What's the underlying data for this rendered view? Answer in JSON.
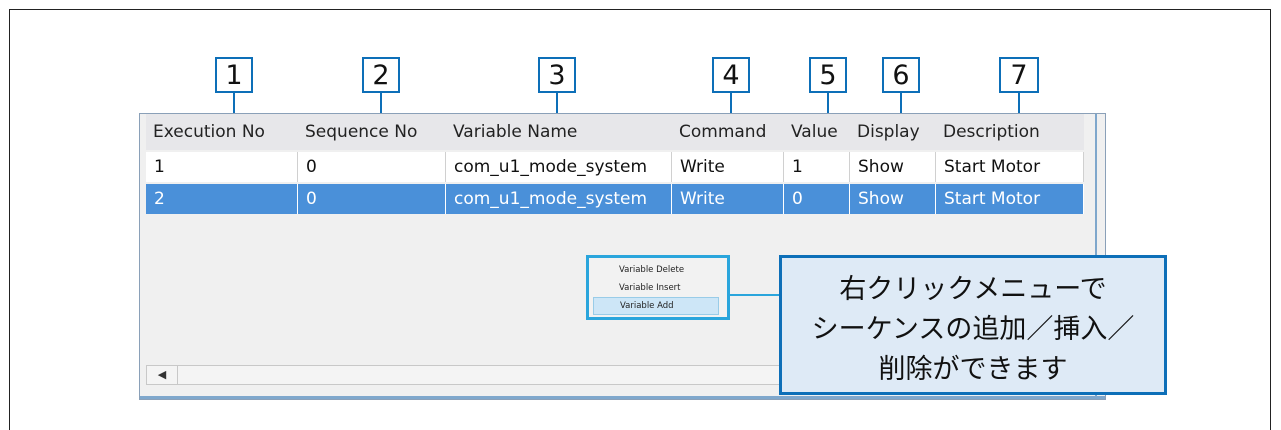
{
  "callouts": [
    "1",
    "2",
    "3",
    "4",
    "5",
    "6",
    "7"
  ],
  "table": {
    "columns": [
      "Execution No",
      "Sequence No",
      "Variable Name",
      "Command",
      "Value",
      "Display",
      "Description"
    ],
    "rows": [
      [
        "1",
        "0",
        "com_u1_mode_system",
        "Write",
        "1",
        "Show",
        "Start Motor"
      ],
      [
        "2",
        "0",
        "com_u1_mode_system",
        "Write",
        "0",
        "Show",
        "Start Motor"
      ]
    ],
    "selected_row": 2
  },
  "scrollbar": {
    "left_arrow_icon": "left-arrow-icon",
    "left_arrow_glyph": "◀"
  },
  "context_menu": {
    "items": [
      "Variable Delete",
      "Variable Insert",
      "Variable Add"
    ],
    "highlighted": "Variable Add"
  },
  "note": {
    "lines": [
      "右クリックメニューで",
      "シーケンスの追加／挿入／",
      "削除ができます"
    ]
  },
  "colors": {
    "callout_border": "#0d6fb8",
    "selected_row": "#4a90d9",
    "note_background": "#deeaf6",
    "menu_border": "#2aa5dc"
  }
}
